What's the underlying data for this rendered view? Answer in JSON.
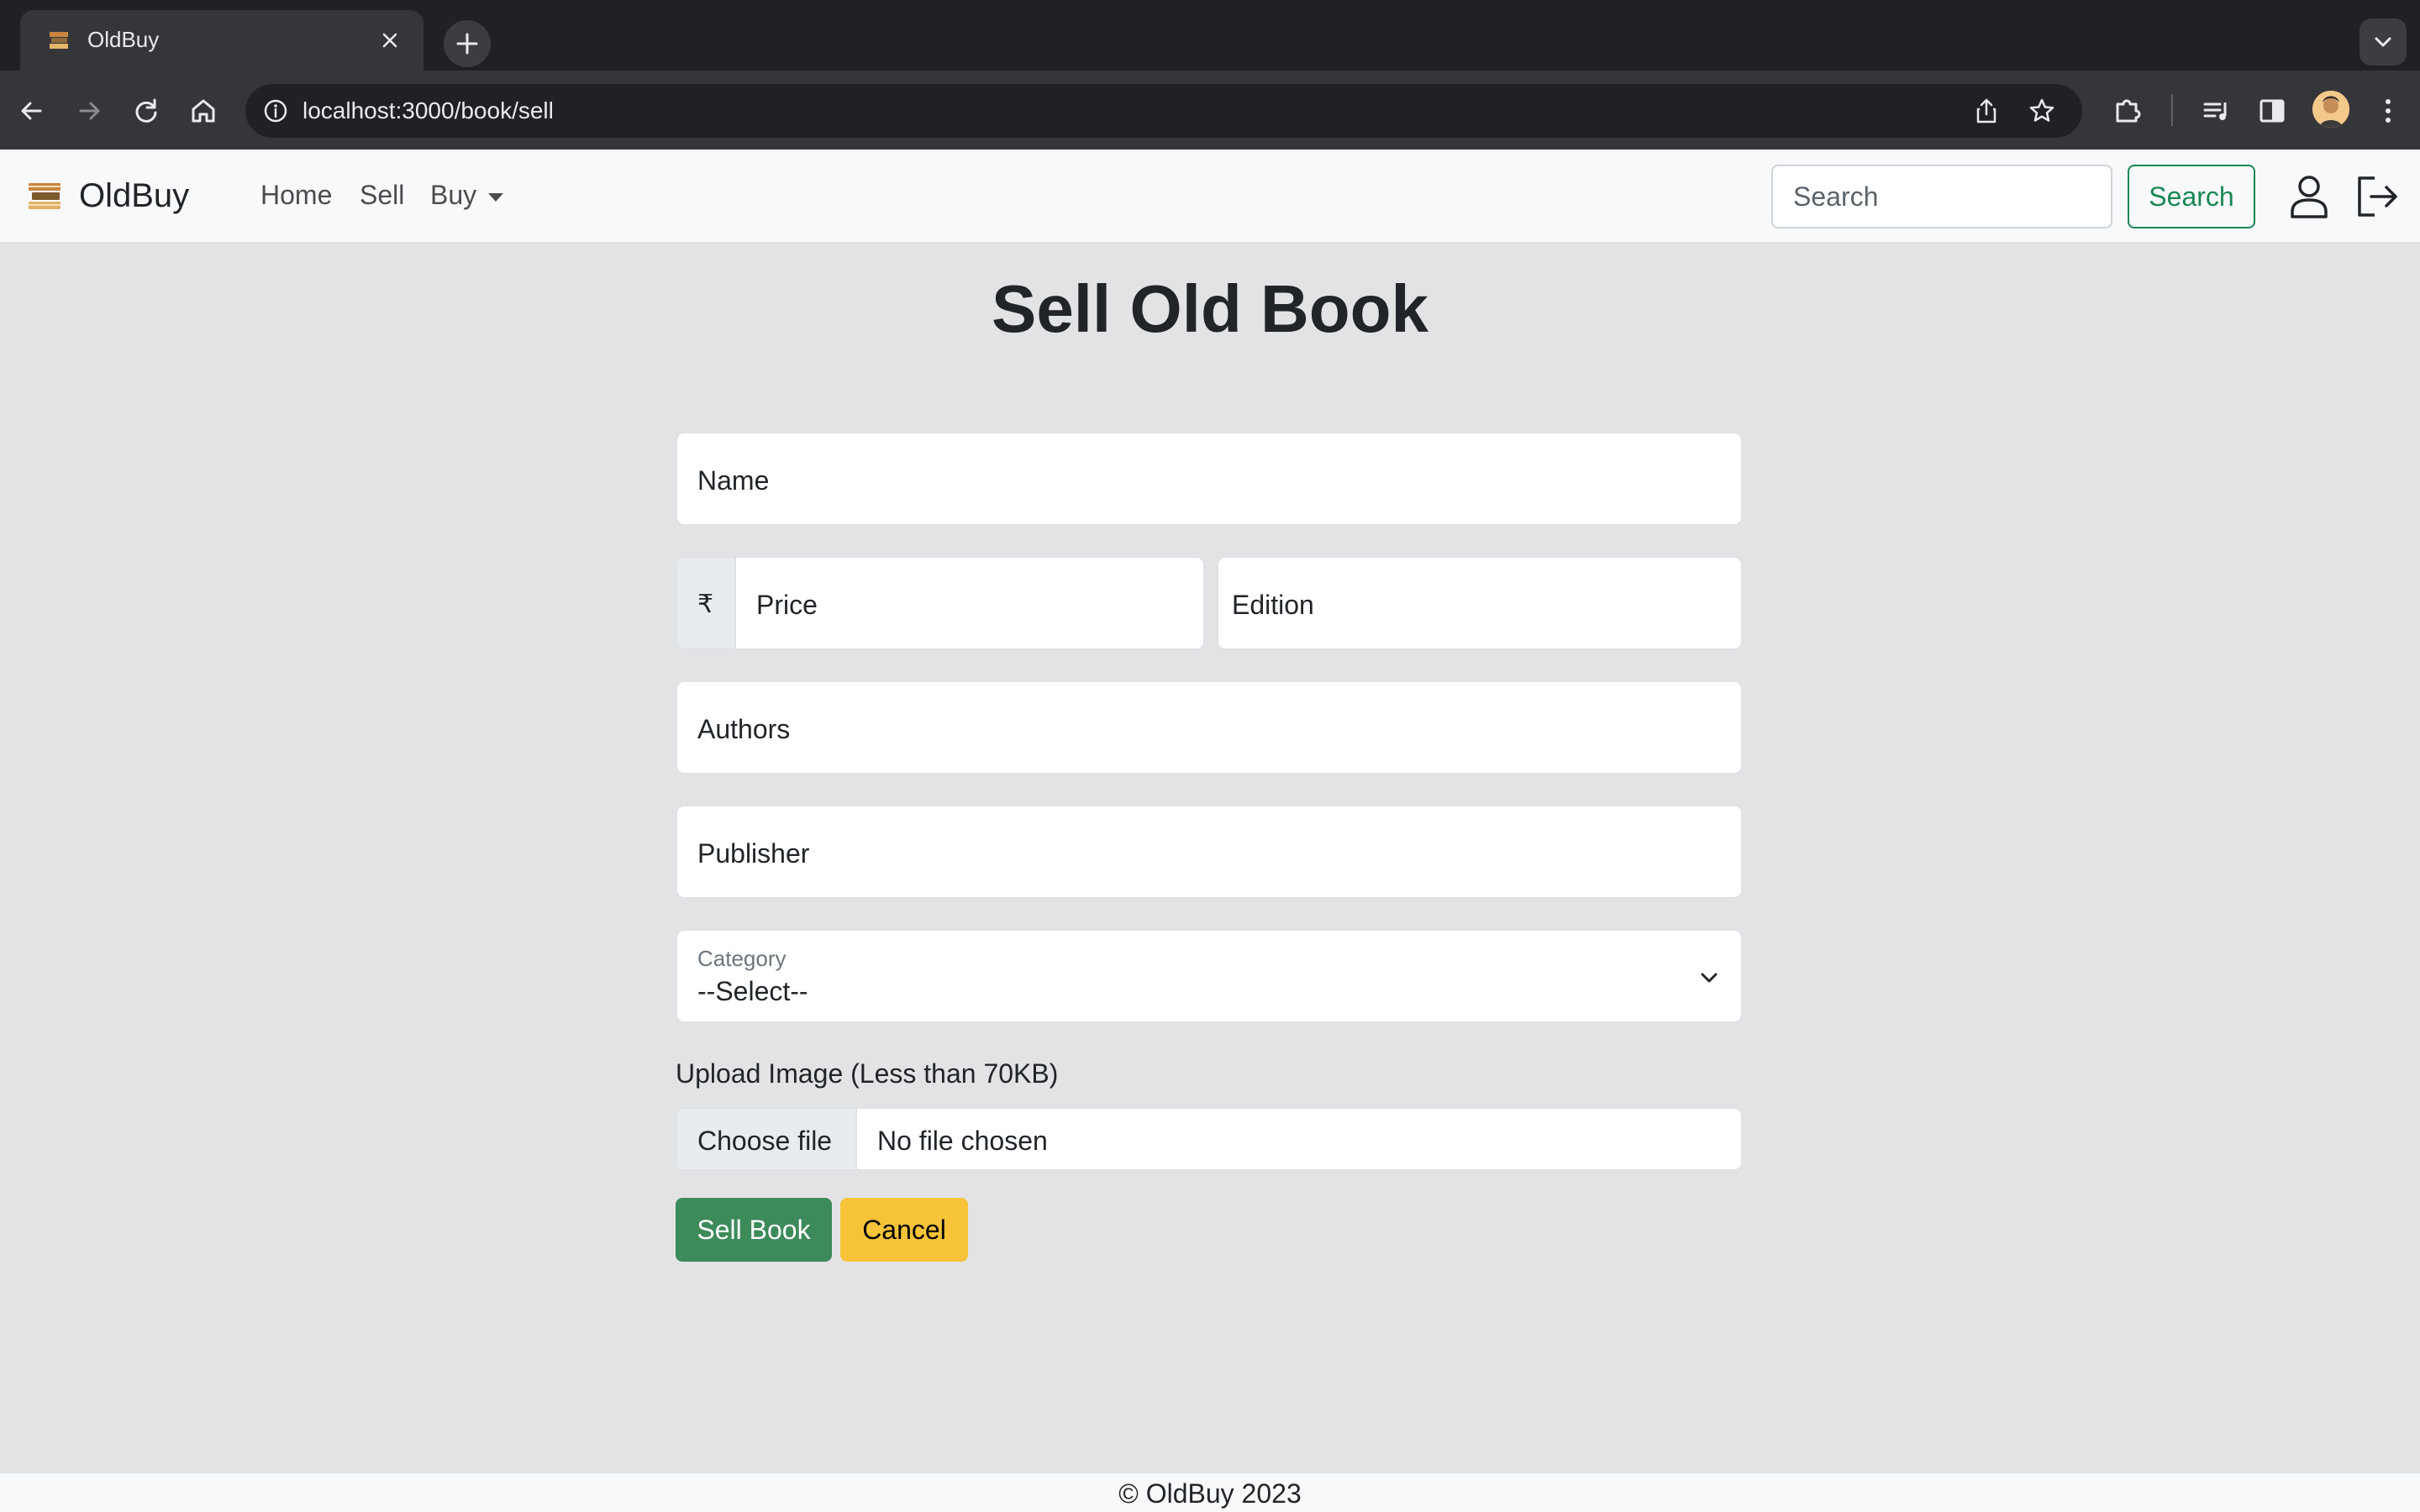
{
  "browser": {
    "tab_title": "OldBuy",
    "url_host": "localhost:3000",
    "url_path": "/book/sell"
  },
  "navbar": {
    "brand": "OldBuy",
    "links": [
      "Home",
      "Sell",
      "Buy"
    ],
    "search_placeholder": "Search",
    "search_button": "Search",
    "icons": [
      "person-icon",
      "logout-icon"
    ]
  },
  "main": {
    "title": "Sell Old Book",
    "form": {
      "name_placeholder": "Name",
      "currency_symbol": "₹",
      "price_placeholder": "Price",
      "edition_placeholder": "Edition",
      "authors_placeholder": "Authors",
      "publisher_placeholder": "Publisher",
      "category_label": "Category",
      "category_selected": "--Select--",
      "upload_label": "Upload Image (Less than 70KB)",
      "file_button": "Choose file",
      "file_status": "No file chosen",
      "submit_label": "Sell Book",
      "cancel_label": "Cancel"
    }
  },
  "footer": {
    "text": "© OldBuy 2023"
  },
  "colors": {
    "success": "#198754",
    "submit_bg": "#3d8a5a",
    "cancel_bg": "#f7c338",
    "page_bg": "#e3e3e5"
  }
}
